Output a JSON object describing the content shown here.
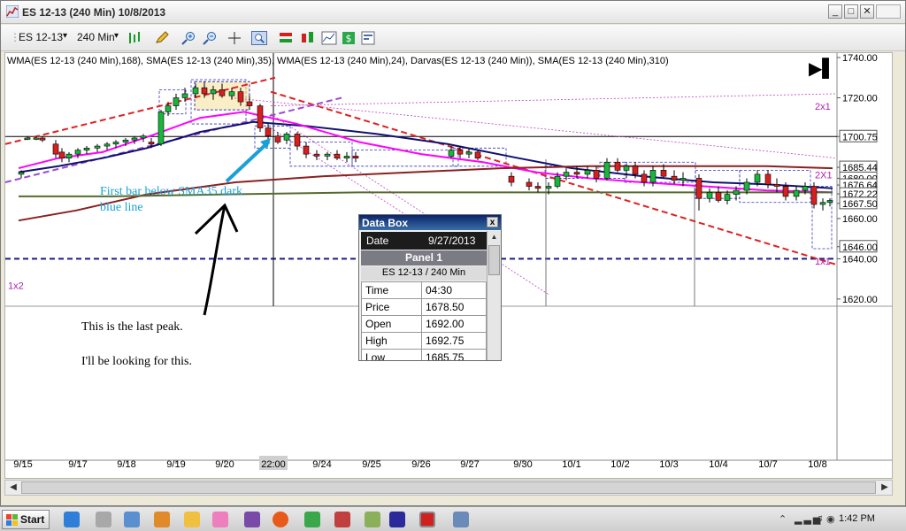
{
  "window": {
    "title": "ES 12-13 (240 Min)  10/8/2013",
    "minimize_glyph": "_",
    "restore_glyph": "□",
    "close_glyph": "✕"
  },
  "toolbar": {
    "instrument": "ES 12-13",
    "interval": "240 Min",
    "dropdown_glyph": "▾",
    "icons": [
      "bar-type-icon",
      "pencil-draw-icon",
      "zoom-in-icon",
      "zoom-out-icon",
      "crosshair-icon",
      "find-icon",
      "indicators-icon",
      "strategy-icon",
      "chart-properties-icon",
      "dollar-icon",
      "data-series-icon"
    ]
  },
  "chart": {
    "indicators_label": "WMA(ES 12-13 (240 Min),168), SMA(ES 12-13 (240 Min),35), WMA(ES 12-13 (240 Min),24), Darvas(ES 12-13 (240 Min)), SMA(ES 12-13 (240 Min),310)",
    "price_axis": [
      "1740.00",
      "1720.00",
      "1700.75",
      "1685.44",
      "1680.00",
      "1676.64",
      "1672.22",
      "1667.50",
      "1660.00",
      "1646.00",
      "1640.00",
      "1620.00"
    ],
    "date_axis": [
      "9/15",
      "9/17",
      "9/18",
      "9/19",
      "9/20",
      "22:00",
      "9/24",
      "9/25",
      "9/26",
      "9/27",
      "9/30",
      "10/1",
      "10/2",
      "10/3",
      "10/4",
      "10/7",
      "10/8"
    ],
    "fib_labels": [
      "2x1",
      "2X1",
      "1x1",
      "1x2"
    ],
    "play_glyph": "▶▌",
    "annotations": {
      "blue_note_line1": "First bar below SMA35 dark",
      "blue_note_line2": "blue line",
      "note_line1": "This is the last peak.",
      "note_line2": "I'll be looking for this."
    },
    "colors": {
      "up": "#19b53c",
      "down": "#d62020",
      "sma35": "#101070",
      "wma24": "#ff00ff",
      "wma168": "#8b2020",
      "sma310": "#556b2f",
      "trend": "#e02020",
      "darvas": "#3030c0",
      "annotation_blue": "#1aa0d8"
    }
  },
  "databox": {
    "title": "Data Box",
    "close_glyph": "x",
    "date_label": "Date",
    "date_value": "9/27/2013",
    "panel": "Panel 1",
    "instrument": "ES 12-13 / 240 Min",
    "rows": [
      {
        "label": "Time",
        "value": "04:30"
      },
      {
        "label": "Price",
        "value": "1678.50"
      },
      {
        "label": "Open",
        "value": "1692.00"
      },
      {
        "label": "High",
        "value": "1692.75"
      },
      {
        "label": "Low",
        "value": "1685.75"
      }
    ]
  },
  "taskbar": {
    "start_label": "Start",
    "clock": "1:42 PM",
    "tray_glyphs": [
      "⌃",
      "♫",
      "◉"
    ]
  }
}
